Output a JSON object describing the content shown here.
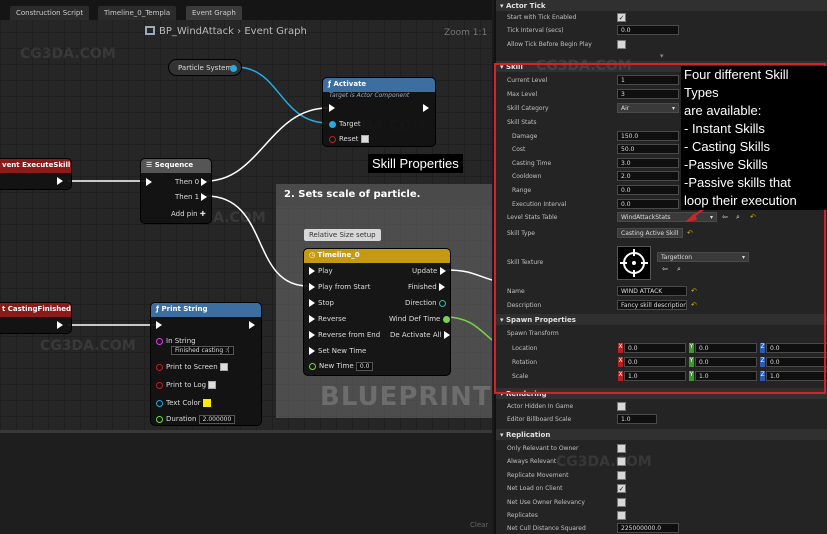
{
  "tabs": [
    "Construction Script",
    "Timeline_0_Templa",
    "Event Graph"
  ],
  "graph_title": "BP_WindAttack",
  "graph_subtitle": "Event Graph",
  "zoom": "Zoom 1:1",
  "watermark": "CG3DA.COM",
  "nodes": {
    "particle_system": "Particle System",
    "activate": {
      "title": "Activate",
      "subtitle": "Target is Actor Component",
      "target": "Target",
      "reset": "Reset"
    },
    "execute_skill": "vent ExecuteSkill",
    "sequence": {
      "title": "Sequence",
      "then0": "Then 0",
      "then1": "Then 1",
      "add_pin": "Add pin"
    },
    "casting_finished": "t CastingFinished",
    "print_string": {
      "title": "Print String",
      "in_string": "In String",
      "in_string_value": "Finished casting :(",
      "print_to_screen": "Print to Screen",
      "print_to_log": "Print to Log",
      "text_color": "Text Color",
      "duration": "Duration",
      "duration_value": "2.000000"
    },
    "timeline": {
      "title": "Timeline_0",
      "play": "Play",
      "play_from_start": "Play from Start",
      "stop": "Stop",
      "reverse": "Reverse",
      "reverse_from_end": "Reverse from End",
      "set_new_time": "Set New Time",
      "new_time": "New Time",
      "new_time_value": "0.0",
      "update": "Update",
      "finished": "Finished",
      "direction": "Direction",
      "wind_def_time": "Wind Def Time",
      "deactivate_all": "De Activate All"
    },
    "relative_size": "Relative Size setup"
  },
  "comment_title": "2. Sets scale of particle.",
  "blueprint_label": "BLUEPRINT",
  "clear_label": "Clear",
  "annotation_skill_properties": "Skill Properties",
  "annotation_note": "Four different Skill Types\nare available:\n- Instant Skills\n- Casting Skills\n-Passive Skills\n-Passive skills that\nloop their execution",
  "details": {
    "actor_tick": {
      "title": "Actor Tick",
      "start_with_tick": "Start with Tick Enabled",
      "tick_interval": "Tick Interval (secs)",
      "tick_interval_value": "0.0",
      "allow_tick": "Allow Tick Before Begin Play"
    },
    "skill": {
      "title": "Skill",
      "current_level": "Current Level",
      "current_level_value": "1",
      "max_level": "Max Level",
      "max_level_value": "3",
      "skill_category": "Skill Category",
      "skill_category_value": "Air",
      "skill_stats": "Skill Stats",
      "stats": [
        {
          "label": "Damage",
          "value": "150.0"
        },
        {
          "label": "Cost",
          "value": "50.0"
        },
        {
          "label": "Casting Time",
          "value": "3.0"
        },
        {
          "label": "Cooldown",
          "value": "2.0"
        },
        {
          "label": "Range",
          "value": "0.0"
        },
        {
          "label": "Execution Interval",
          "value": "0.0"
        }
      ],
      "level_stats_table": "Level Stats Table",
      "level_stats_table_value": "WindAttackStats",
      "skill_type": "Skill Type",
      "skill_type_value": "Casting Active Skill",
      "skill_texture": "Skill Texture",
      "skill_texture_value": "TargetIcon",
      "name": "Name",
      "name_value": "WIND ATTACK",
      "description": "Description",
      "description_value": "Fancy skill description"
    },
    "spawn": {
      "title": "Spawn Properties",
      "spawn_transform": "Spawn Transform",
      "location": "Location",
      "location_values": [
        "0.0",
        "0.0",
        "0.0"
      ],
      "rotation": "Rotation",
      "rotation_values": [
        "0.0",
        "0.0",
        "0.0"
      ],
      "scale": "Scale",
      "scale_values": [
        "1.0",
        "1.0",
        "1.0"
      ]
    },
    "rendering": {
      "title": "Rendering",
      "actor_hidden": "Actor Hidden In Game",
      "billboard_scale": "Editor Billboard Scale",
      "billboard_scale_value": "1.0"
    },
    "replication": {
      "title": "Replication",
      "only_relevant": "Only Relevant to Owner",
      "always_relevant": "Always Relevant",
      "replicate_movement": "Replicate Movement",
      "net_load": "Net Load on Client",
      "net_use_owner": "Net Use Owner Relevancy",
      "replicates": "Replicates",
      "net_cull": "Net Cull Distance Squared",
      "net_cull_value": "225000000.0"
    },
    "axis": [
      "X",
      "Y",
      "Z"
    ]
  },
  "colors": {
    "exec_red": "#8b1a1a",
    "function_blue": "#3c6ea0",
    "timeline_yellow": "#c59a10",
    "highlight_red": "#d2232a"
  }
}
